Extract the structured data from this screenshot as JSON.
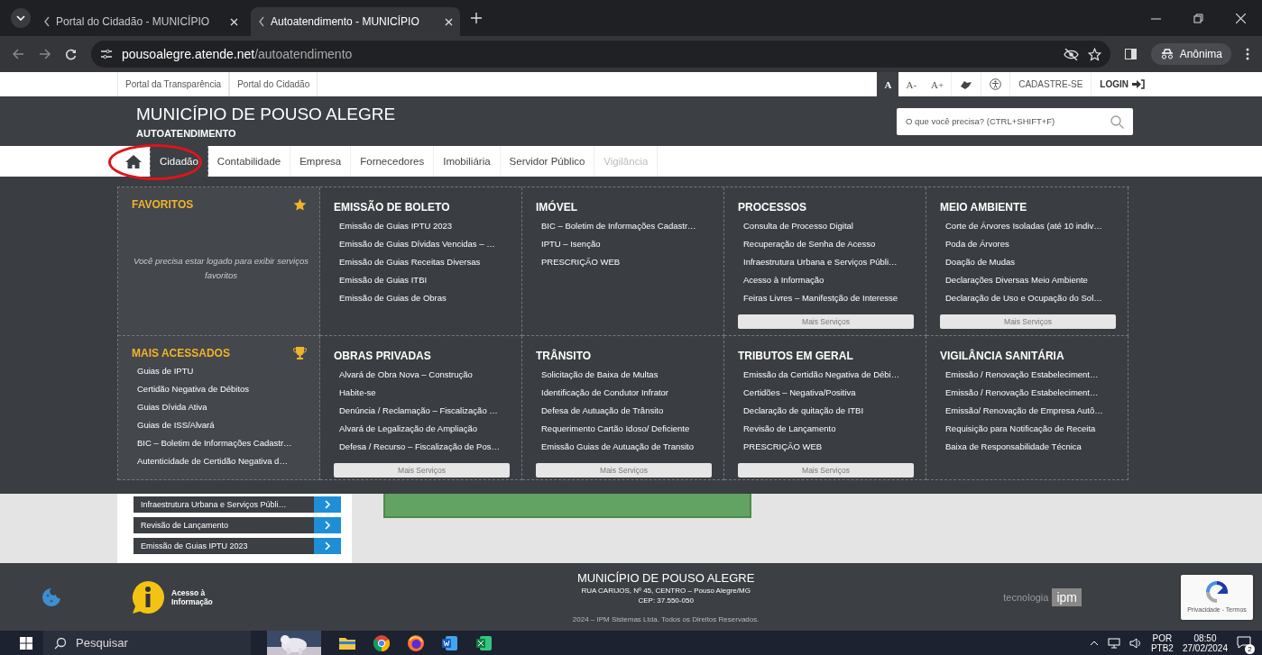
{
  "browser": {
    "tabs": [
      {
        "title": "Portal do Cidadão - MUNICÍPIO",
        "selected": false
      },
      {
        "title": "Autoatendimento - MUNICÍPIO",
        "selected": true
      }
    ],
    "url_host": "pousoalegre.atende.net",
    "url_path": "/autoatendimento",
    "profile": "Anônima"
  },
  "topbar": {
    "links": [
      "Portal da Transparência",
      "Portal do Cidadão"
    ],
    "font_sizes": [
      {
        "label": "A",
        "selected": true
      },
      {
        "label": "A-",
        "selected": false
      },
      {
        "label": "A+",
        "selected": false
      }
    ],
    "signup": "CADASTRE-SE",
    "login": "LOGIN"
  },
  "header": {
    "title": "MUNICÍPIO DE POUSO ALEGRE",
    "subtitle": "AUTOATENDIMENTO",
    "search_placeholder": "O que você precisa? (CTRL+SHIFT+F)"
  },
  "nav": [
    {
      "label": "Cidadão",
      "selected": true,
      "disabled": false
    },
    {
      "label": "Contabilidade",
      "selected": false,
      "disabled": false
    },
    {
      "label": "Empresa",
      "selected": false,
      "disabled": false
    },
    {
      "label": "Fornecedores",
      "selected": false,
      "disabled": false
    },
    {
      "label": "Imobiliária",
      "selected": false,
      "disabled": false
    },
    {
      "label": "Servidor Público",
      "selected": false,
      "disabled": false
    },
    {
      "label": "Vigilância",
      "selected": false,
      "disabled": true
    }
  ],
  "menu": [
    {
      "kind": "favorites",
      "title": "FAVORITOS",
      "message": "Você precisa estar logado para exibir serviços favoritos"
    },
    {
      "kind": "services",
      "title": "EMISSÃO DE BOLETO",
      "items": [
        "Emissão de Guias IPTU 2023",
        "Emissão de Guias Dívidas Vencidas – …",
        "Emissão de Guias Receitas Diversas",
        "Emissão de Guias ITBI",
        "Emissão de Guias de Obras"
      ]
    },
    {
      "kind": "services",
      "title": "IMÓVEL",
      "items": [
        "BIC – Boletim de Informações Cadastr…",
        "IPTU – Isenção",
        "PRESCRIÇÃO WEB"
      ]
    },
    {
      "kind": "services",
      "title": "PROCESSOS",
      "items": [
        "Consulta de Processo Digital",
        "Recuperação de Senha de Acesso",
        "Infraestrutura Urbana e Serviços Públi…",
        "Acesso à Informação",
        "Feiras Livres – Manifestção de Interesse"
      ],
      "more": "Mais Serviços"
    },
    {
      "kind": "services",
      "title": "MEIO AMBIENTE",
      "items": [
        "Corte de Árvores Isoladas (até 10 indiv…",
        "Poda de Árvores",
        "Doação de Mudas",
        "Declarações Diversas Meio Ambiente",
        "Declaração de Uso e Ocupação do Sol…"
      ],
      "more": "Mais Serviços"
    },
    {
      "kind": "ranking",
      "title": "MAIS ACESSADOS",
      "items": [
        "Guias de IPTU",
        "Certidão Negativa de Débitos",
        "Guias Dívida Ativa",
        "Guias de ISS/Alvará",
        "BIC – Boletim de Informações Cadastr…",
        "Autenticidade de Certidão Negativa d…"
      ]
    },
    {
      "kind": "services",
      "title": "OBRAS PRIVADAS",
      "items": [
        "Alvará de Obra Nova – Construção",
        "Habite-se",
        "Denúncia / Reclamação – Fiscalização …",
        "Alvará de Legalização de Ampliação",
        "Defesa / Recurso – Fiscalização de Pos…"
      ],
      "more": "Mais Serviços"
    },
    {
      "kind": "services",
      "title": "TRÂNSITO",
      "items": [
        "Solicitação de Baixa de Multas",
        "Identificação de Condutor Infrator",
        "Defesa de Autuação de Trânsito",
        "Requerimento Cartão Idoso/ Deficiente",
        "Emissão Guias de Autuação de Transito"
      ],
      "more": "Mais Serviços"
    },
    {
      "kind": "services",
      "title": "TRIBUTOS EM GERAL",
      "items": [
        "Emissão da Certidão Negativa de Débi…",
        "Certidões – Negativa/Positiva",
        "Declaração de quitação de ITBI",
        "Revisão de Lançamento",
        "PRESCRIÇÃO WEB"
      ],
      "more": "Mais Serviços"
    },
    {
      "kind": "services",
      "title": "VIGILÂNCIA SANITÁRIA",
      "items": [
        "Emissão / Renovação Estabeleciment…",
        "Emissão / Renovação Estabeleciment…",
        "Emissão/ Renovação de Empresa Autô…",
        "Requisição para Notificação de Receita",
        "Baixa de Responsabilidade Técnica"
      ]
    }
  ],
  "quick_links": [
    "Infraestrutura Urbana e Serviços Públi…",
    "Revisão de Lançamento",
    "Emissão de Guias IPTU 2023"
  ],
  "footer": {
    "access_label": "Acesso à Informação",
    "title": "MUNICÍPIO DE POUSO ALEGRE",
    "address": "RUA CARIJOS, Nº 45, CENTRO – Pouso Alegre/MG",
    "cep": "CEP: 37.550-050",
    "copyright": "2024 – IPM Sistemas Ltda. Todos os Direitos Reservados.",
    "tech": "tecnologia",
    "brand": "ipm",
    "recaptcha": "Privacidade - Termos"
  },
  "taskbar": {
    "search": "Pesquisar",
    "lang": "POR",
    "layout": "PTB2",
    "time": "08:50",
    "date": "27/02/2024",
    "notifications": "2"
  }
}
